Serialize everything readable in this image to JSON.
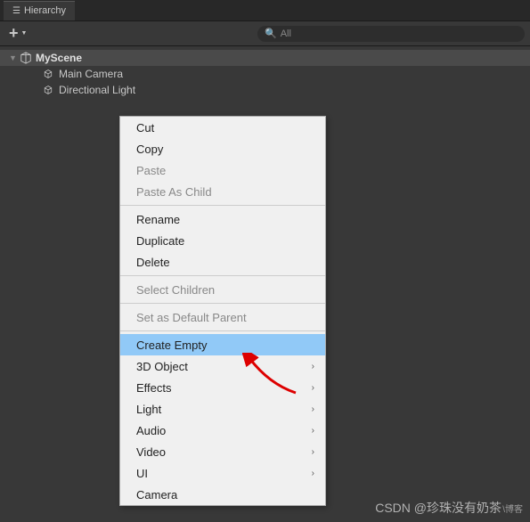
{
  "tab": {
    "title": "Hierarchy"
  },
  "search": {
    "placeholder": "All"
  },
  "tree": {
    "scene": "MyScene",
    "children": [
      "Main Camera",
      "Directional Light"
    ]
  },
  "menu": {
    "cut": "Cut",
    "copy": "Copy",
    "paste": "Paste",
    "pasteAsChild": "Paste As Child",
    "rename": "Rename",
    "duplicate": "Duplicate",
    "delete": "Delete",
    "selectChildren": "Select Children",
    "setDefaultParent": "Set as Default Parent",
    "createEmpty": "Create Empty",
    "object3d": "3D Object",
    "effects": "Effects",
    "light": "Light",
    "audio": "Audio",
    "video": "Video",
    "ui": "UI",
    "camera": "Camera"
  },
  "watermark": {
    "main": "CSDN @珍珠没有奶茶",
    "sub": "\\博客"
  }
}
